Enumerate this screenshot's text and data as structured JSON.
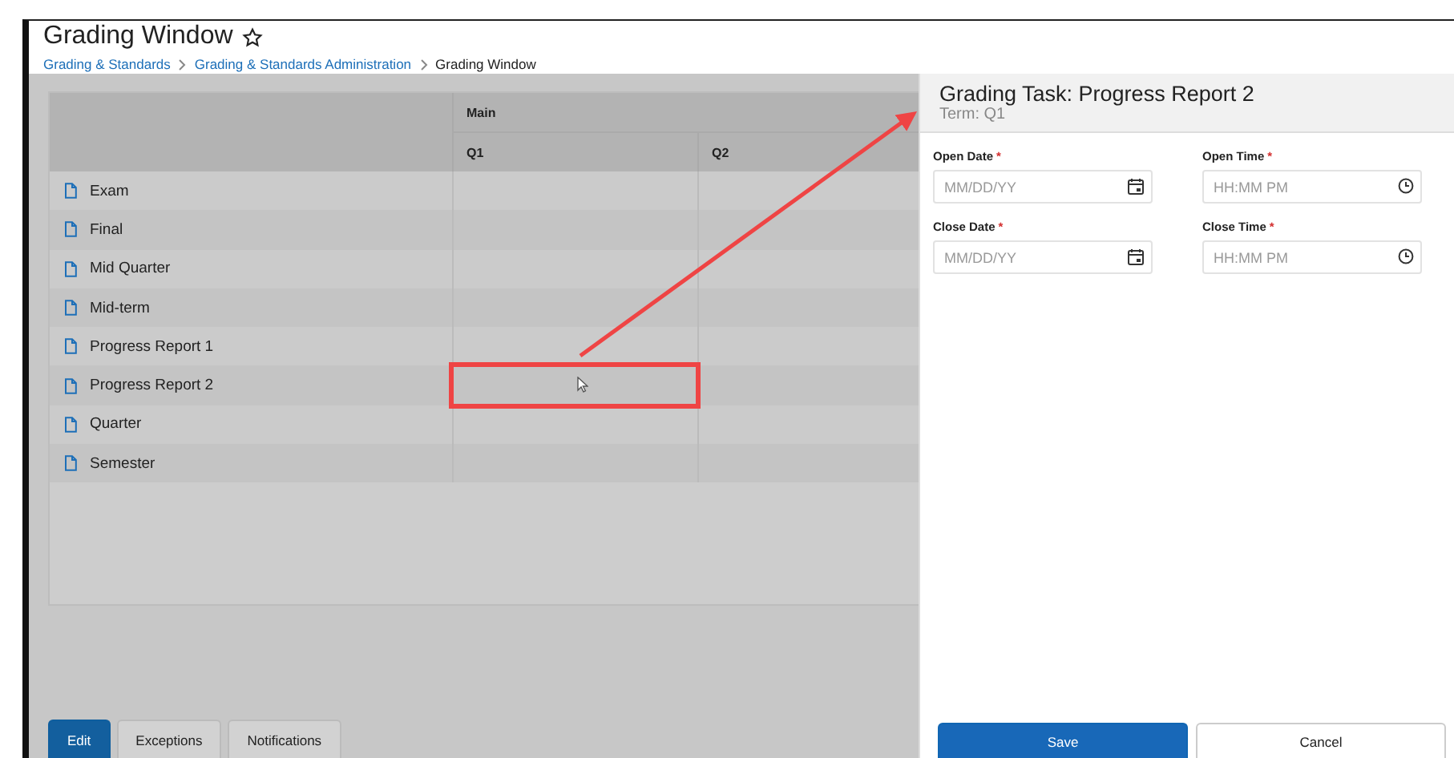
{
  "page": {
    "title": "Grading Window",
    "favorite": false,
    "breadcrumb": [
      {
        "label": "Grading & Standards",
        "link": true
      },
      {
        "label": "Grading & Standards Administration",
        "link": true
      },
      {
        "label": "Grading Window",
        "link": false
      }
    ]
  },
  "table": {
    "group_header": "Main",
    "columns": [
      "Q1",
      "Q2"
    ],
    "rows": [
      {
        "name": "Exam",
        "highlighted": false
      },
      {
        "name": "Final",
        "highlighted": false
      },
      {
        "name": "Mid Quarter",
        "highlighted": false
      },
      {
        "name": "Mid-term",
        "highlighted": false
      },
      {
        "name": "Progress Report 1",
        "highlighted": false
      },
      {
        "name": "Progress Report 2",
        "highlighted": true
      },
      {
        "name": "Quarter",
        "highlighted": false
      },
      {
        "name": "Semester",
        "highlighted": false
      }
    ]
  },
  "bottom_tabs": [
    {
      "label": "Edit",
      "selected": true
    },
    {
      "label": "Exceptions",
      "selected": false
    },
    {
      "label": "Notifications",
      "selected": false
    }
  ],
  "side_panel": {
    "title": "Grading Task: Progress Report 2",
    "subtitle": "Term: Q1",
    "fields": [
      {
        "label": "Open Date",
        "required_mark": "*",
        "placeholder": "MM/DD/YY",
        "kind": "date"
      },
      {
        "label": "Open Time",
        "required_mark": "*",
        "placeholder": "HH:MM PM",
        "kind": "time"
      },
      {
        "label": "Close Date",
        "required_mark": "*",
        "placeholder": "MM/DD/YY",
        "kind": "date"
      },
      {
        "label": "Close Time",
        "required_mark": "*",
        "placeholder": "HH:MM PM",
        "kind": "time"
      }
    ],
    "buttons": [
      {
        "label": "Save",
        "kind": "primary"
      },
      {
        "label": "Cancel",
        "kind": "secondary"
      }
    ]
  }
}
